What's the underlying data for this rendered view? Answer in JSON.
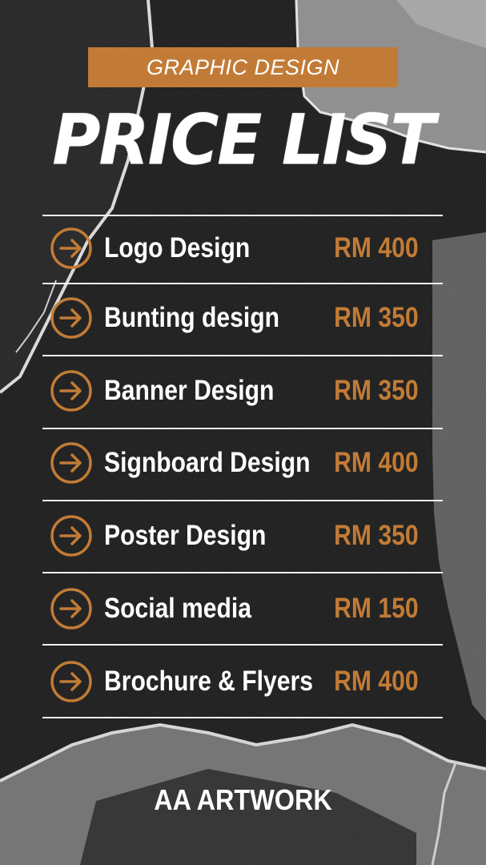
{
  "header": {
    "tag": "GRAPHIC DESIGN",
    "title": "PRICE LIST"
  },
  "items": [
    {
      "service": "Logo Design",
      "price": "RM 400",
      "icon": "arrow-right-circle-icon"
    },
    {
      "service": "Bunting design",
      "price": "RM 350",
      "icon": "arrow-right-circle-icon"
    },
    {
      "service": "Banner Design",
      "price": "RM 350",
      "icon": "arrow-right-circle-icon"
    },
    {
      "service": "Signboard Design",
      "price": "RM 400",
      "icon": "arrow-right-circle-icon"
    },
    {
      "service": "Poster Design",
      "price": "RM 350",
      "icon": "arrow-right-circle-icon"
    },
    {
      "service": "Social media",
      "price": "RM 150",
      "icon": "arrow-right-circle-icon"
    },
    {
      "service": "Brochure & Flyers",
      "price": "RM 400",
      "icon": "arrow-right-circle-icon"
    }
  ],
  "footer": {
    "brand": "AA ARTWORK"
  },
  "colors": {
    "accent": "#c27b36",
    "background": "#141414",
    "text": "#ffffff"
  }
}
